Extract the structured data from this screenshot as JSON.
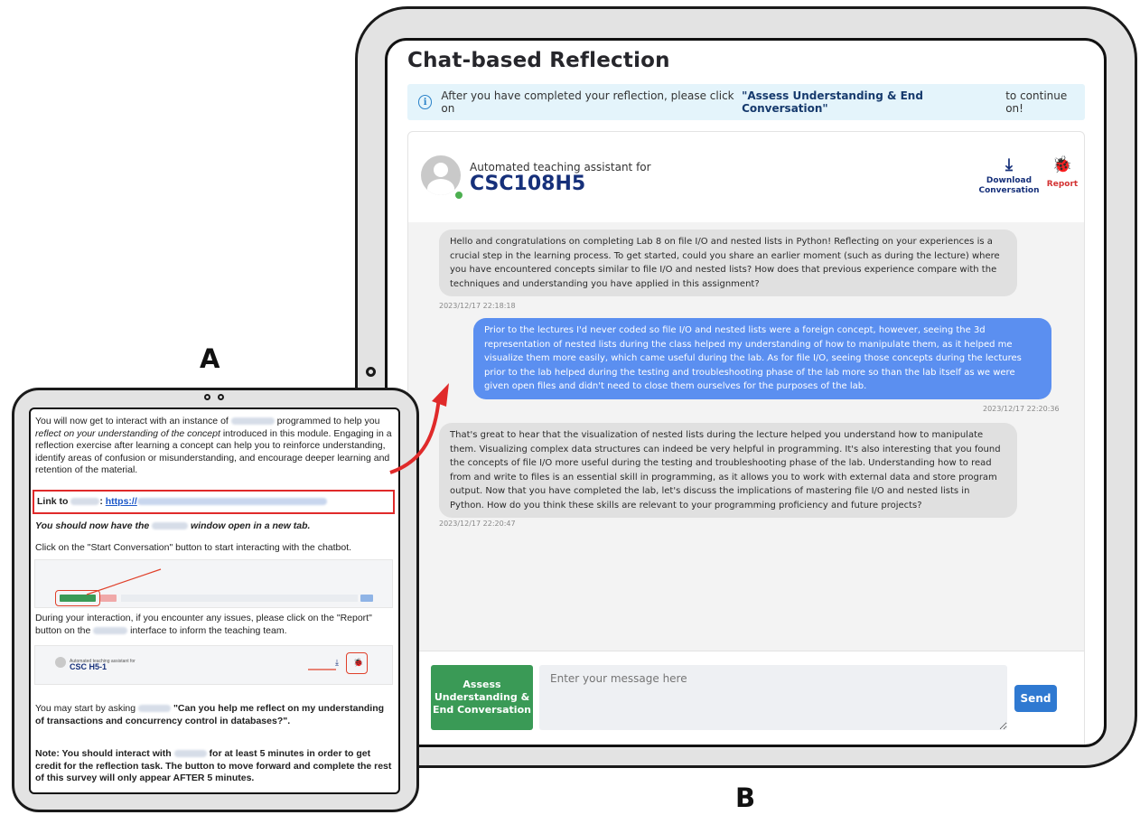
{
  "labels": {
    "a": "A",
    "b": "B"
  },
  "chat": {
    "page_title": "Chat-based Reflection",
    "info_banner": {
      "prefix": "After you have completed your reflection, please click on",
      "highlight": "\"Assess Understanding & End Conversation\"",
      "suffix": "to continue on!"
    },
    "header": {
      "subtitle": "Automated teaching assistant for",
      "course_code": "CSC108H5",
      "download_label": "Download Conversation",
      "report_label": "Report"
    },
    "messages": [
      {
        "role": "assistant",
        "text": "Hello and congratulations on completing Lab 8 on file I/O and nested lists in Python! Reflecting on your experiences is a crucial step in the learning process. To get started, could you share an earlier moment (such as during the lecture) where you have encountered concepts similar to file I/O and nested lists? How does that previous experience compare with the techniques and understanding you have applied in this assignment?",
        "timestamp": "2023/12/17 22:18:18"
      },
      {
        "role": "user",
        "text": "Prior to the lectures I'd never coded so file I/O and nested lists were a foreign concept, however, seeing the 3d representation of nested lists during the class helped my understanding of how to manipulate them, as it helped me visualize them more easily, which came useful during the lab. As for file I/O, seeing those concepts during the lectures prior to the lab helped during the testing and troubleshooting phase of the lab more so than the lab itself as we were given open files and didn't need to close them ourselves for the purposes of the lab.",
        "timestamp": "2023/12/17 22:20:36"
      },
      {
        "role": "assistant",
        "text": "That's great to hear that the visualization of nested lists during the lecture helped you understand how to manipulate them. Visualizing complex data structures can indeed be very helpful in programming. It's also interesting that you found the concepts of file I/O more useful during the testing and troubleshooting phase of the lab. Understanding how to read from and write to files is an essential skill in programming, as it allows you to work with external data and store program output. Now that you have completed the lab, let's discuss the implications of mastering file I/O and nested lists in Python. How do you think these skills are relevant to your programming proficiency and future projects?",
        "timestamp": "2023/12/17 22:20:47"
      }
    ],
    "assess_button": "Assess Understanding & End Conversation",
    "input_placeholder": "Enter your message here",
    "send_button": "Send"
  },
  "survey": {
    "intro_1": "You will now get to interact with an instance of",
    "intro_2": "programmed to help you",
    "intro_italic": "reflect on your understanding of the concept",
    "intro_3": "introduced in this module. Engaging in a reflection exercise after learning a concept can help you to reinforce understanding, identify areas of confusion or misunderstanding, and encourage deeper learning and retention of the material.",
    "link_prefix": "Link to",
    "link_url": "https://",
    "window_1": "You should now have the",
    "window_2": "window open in a new tab.",
    "start_instruction": "Click on the \"Start Conversation\" button to start interacting with the chatbot.",
    "report_1": "During your interaction, if you encounter any issues, please click on the \"Report\" button on the",
    "report_2": "interface to inform the teaching team.",
    "ask_1": "You may start by asking",
    "ask_bold": "\"Can you help me reflect on my understanding of transactions and concurrency control in databases?\".",
    "note_1": "Note: You should interact with",
    "note_2": "for at least 5 minutes in order to get credit for the reflection task. The button to move forward and complete the rest of this survey will only appear AFTER 5 minutes.",
    "mini_header": {
      "subtitle": "Automated teaching assistant for",
      "course_code": "CSC   H5-1"
    }
  },
  "colors": {
    "assistant_bubble": "#e0e0e0",
    "user_bubble": "#5b8ff0",
    "assess_button": "#3a9a56",
    "send_button": "#2f79d1",
    "report": "#d33232",
    "annotation_red": "#e02a2a"
  },
  "icons": [
    "info-icon",
    "download-icon",
    "bug-icon",
    "avatar-icon",
    "arrow-annotation"
  ]
}
